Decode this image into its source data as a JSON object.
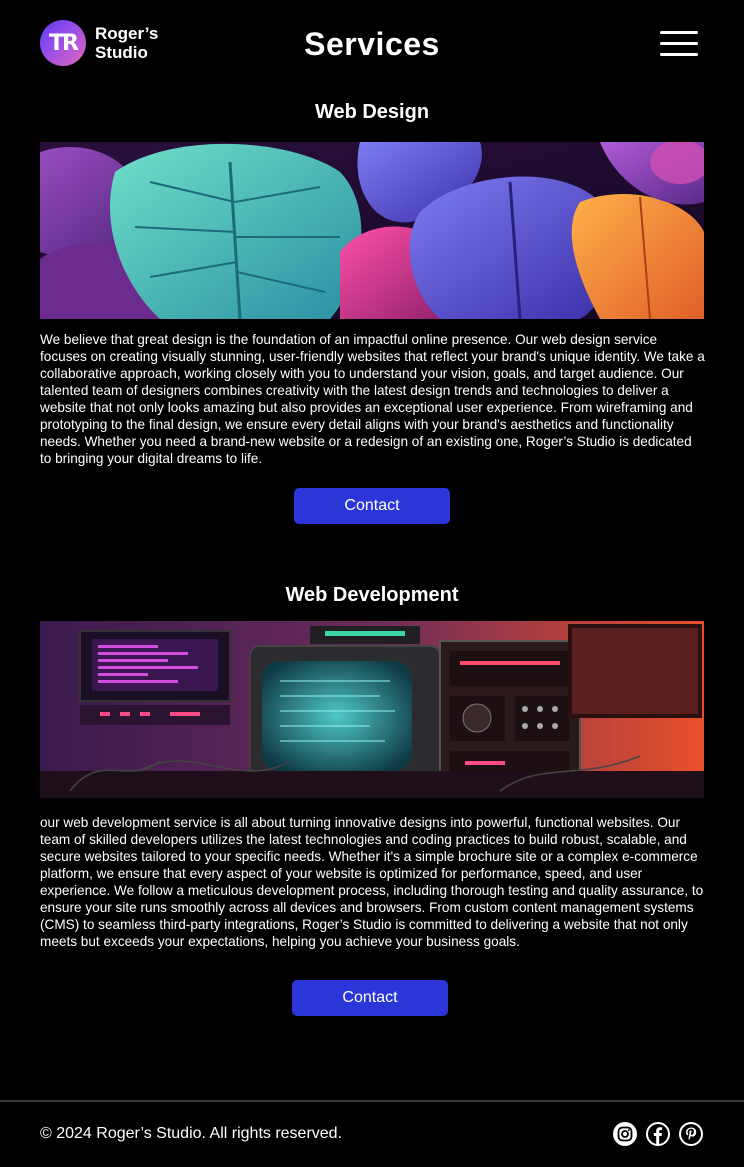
{
  "header": {
    "logo_mark": "TR",
    "logo_line1": "Roger’s",
    "logo_line2": "Studio",
    "title": "Services"
  },
  "sections": [
    {
      "title": "Web Design",
      "image_icon": "neon-monstera-leaves-image",
      "text": "We believe that great design is the foundation of an impactful online presence. Our web design service focuses on creating visually stunning, user-friendly websites that reflect your brand's unique identity. We take a collaborative approach, working closely with you to understand your vision, goals, and target audience. Our talented team of designers combines creativity with the latest design trends and technologies to deliver a website that not only looks amazing but also provides an exceptional user experience. From wireframing and prototyping to the final design, we ensure every detail aligns with your brand's aesthetics and functionality needs. Whether you need a brand-new website or a redesign of an existing one, Roger’s Studio is dedicated to bringing your digital dreams to life.",
      "button": "Contact"
    },
    {
      "title": "Web Development",
      "image_icon": "retro-computer-monitors-image",
      "text": "our web development service is all about turning innovative designs into powerful, functional websites. Our team of skilled developers utilizes the latest technologies and coding practices to build robust, scalable, and secure websites tailored to your specific needs. Whether it's a simple brochure site or a complex e-commerce platform, we ensure that every aspect of your website is optimized for performance, speed, and user experience. We follow a meticulous development process, including thorough testing and quality assurance, to ensure your site runs smoothly across all devices and browsers. From custom content management systems (CMS) to seamless third-party integrations, Roger’s Studio is committed to delivering a website that not only meets but exceeds your expectations, helping you achieve your business goals.",
      "button": "Contact"
    }
  ],
  "footer": {
    "copyright": "© 2024 Roger’s Studio. All rights reserved.",
    "social_icons": [
      "instagram-icon",
      "facebook-icon",
      "pinterest-icon"
    ]
  },
  "colors": {
    "background": "#000000",
    "button": "#2a36d8",
    "text": "#ffffff"
  }
}
